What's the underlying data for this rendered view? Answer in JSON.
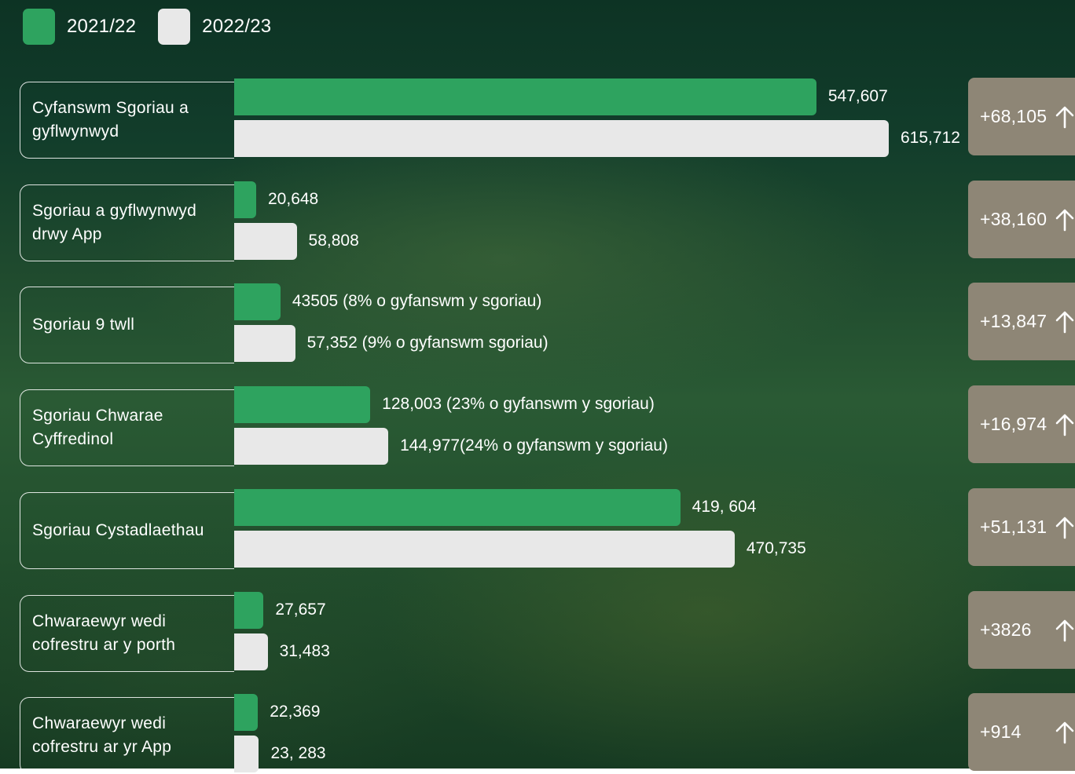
{
  "colors": {
    "series_2021": "#2ea35f",
    "series_2022": "#e8e8e8",
    "change_box": "#8e8676"
  },
  "legend": [
    {
      "label": "2021/22",
      "color": "#2ea35f"
    },
    {
      "label": "2022/23",
      "color": "#e8e8e8"
    }
  ],
  "chart_data": {
    "type": "bar",
    "orientation": "horizontal",
    "categories": [
      "Cyfanswm Sgoriau a gyflwynwyd",
      "Sgoriau a gyflwynwyd drwy App",
      "Sgoriau 9 twll",
      "Sgoriau Chwarae Cyffredinol",
      "Sgoriau Cystadlaethau",
      "Chwaraewyr wedi cofrestru ar y porth",
      "Chwaraewyr wedi cofrestru ar yr App"
    ],
    "series": [
      {
        "name": "2021/22",
        "values": [
          547607,
          20648,
          43505,
          128003,
          419604,
          27657,
          22369
        ],
        "labels": [
          "547,607",
          "20,648",
          "43505 (8% o gyfanswm y sgoriau)",
          "128,003 (23% o gyfanswm y sgoriau)",
          "419, 604",
          "27,657",
          "22,369"
        ]
      },
      {
        "name": "2022/23",
        "values": [
          615712,
          58808,
          57352,
          144977,
          470735,
          31483,
          23283
        ],
        "labels": [
          "615,712",
          "58,808",
          "57,352 (9% o gyfanswm sgoriau)",
          "144,977(24% o gyfanswm y sgoriau)",
          "470,735",
          "31,483",
          "23, 283"
        ]
      }
    ],
    "changes": [
      "+68,105",
      "+38,160",
      "+13,847",
      "+16,974",
      "+51,131",
      "+3826",
      "+914"
    ],
    "grid": false,
    "legend_position": "top-left"
  }
}
